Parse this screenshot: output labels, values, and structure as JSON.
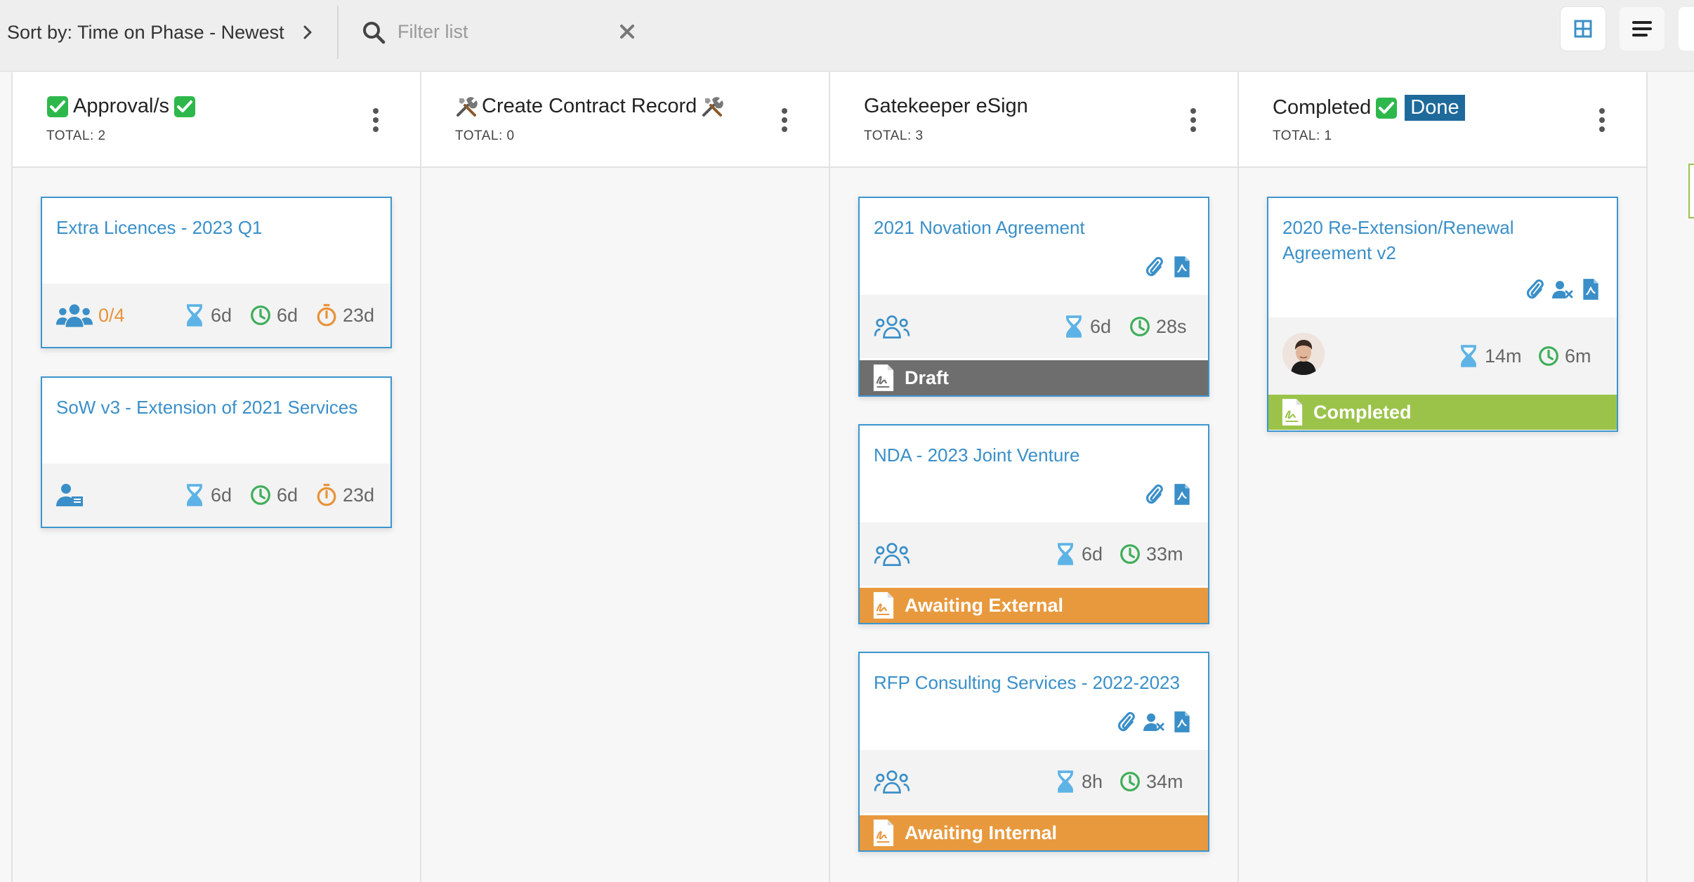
{
  "toolbar": {
    "sort_label": "Sort by: Time on Phase - Newest",
    "filter_placeholder": "Filter list"
  },
  "colors": {
    "accent": "#3a8fc8",
    "draft": "#6e6e6e",
    "awaiting": "#e8993d",
    "completed": "#9bc34a",
    "done_badge": "#1e6a9b"
  },
  "columns": [
    {
      "title": "Approval/s",
      "total": "TOTAL: 2",
      "cards": [
        {
          "title": "Extra Licences - 2023 Q1",
          "approvals": "0/4",
          "hourglass": "6d",
          "clock": "6d",
          "timer": "23d"
        },
        {
          "title": "SoW v3 - Extension of 2021 Services",
          "hourglass": "6d",
          "clock": "6d",
          "timer": "23d"
        }
      ]
    },
    {
      "title": "Create Contract Record",
      "total": "TOTAL: 0",
      "cards": []
    },
    {
      "title": "Gatekeeper eSign",
      "total": "TOTAL: 3",
      "cards": [
        {
          "title": "2021 Novation Agreement",
          "hourglass": "6d",
          "clock": "28s",
          "status": "Draft"
        },
        {
          "title": "NDA - 2023 Joint Venture",
          "hourglass": "6d",
          "clock": "33m",
          "status": "Awaiting External"
        },
        {
          "title": "RFP Consulting Services - 2022-2023",
          "hourglass": "8h",
          "clock": "34m",
          "status": "Awaiting Internal"
        }
      ]
    },
    {
      "title": "Completed",
      "badge": "Done",
      "total": "TOTAL: 1",
      "cards": [
        {
          "title": "2020 Re-Extension/Renewal Agreement v2",
          "hourglass": "14m",
          "clock": "6m",
          "status": "Completed"
        }
      ]
    }
  ]
}
